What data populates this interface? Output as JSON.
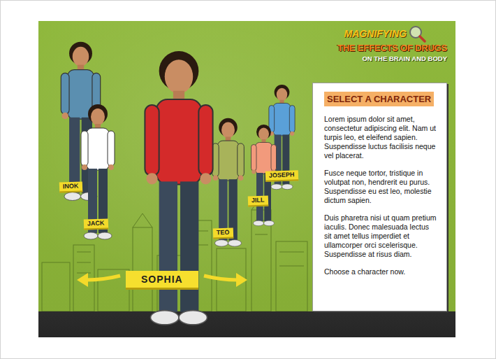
{
  "header": {
    "kicker": "MAGNIFYING",
    "title": "THE EFFECTS OF DRUGS",
    "subtitle": "ON THE BRAIN AND BODY"
  },
  "characters": [
    {
      "name": "INOK",
      "selected": false,
      "color": "#5b8fb0"
    },
    {
      "name": "JACK",
      "selected": false,
      "color": "#ffffff"
    },
    {
      "name": "SOPHIA",
      "selected": true,
      "color": "#d42a2a"
    },
    {
      "name": "TEO",
      "selected": false,
      "color": "#a8b35a"
    },
    {
      "name": "JILL",
      "selected": false,
      "color": "#f29a7c"
    },
    {
      "name": "JOSEPH",
      "selected": false,
      "color": "#5aa0d8"
    }
  ],
  "panel": {
    "heading": "SELECT A CHARACTER",
    "paragraphs": [
      "Lorem ipsum dolor sit amet, consectetur adipiscing elit. Nam ut turpis leo, et eleifend sapien. Suspendisse luctus facilisis neque vel placerat.",
      "Fusce neque tortor, tristique in volutpat non, hendrerit eu purus. Suspendisse eu est leo, molestie dictum sapien.",
      "Duis pharetra nisi ut quam pretium iaculis. Donec malesuada lectus sit amet tellus imperdiet et ullamcorper orci scelerisque. Suspendisse at risus diam.",
      "Choose a character now."
    ]
  }
}
